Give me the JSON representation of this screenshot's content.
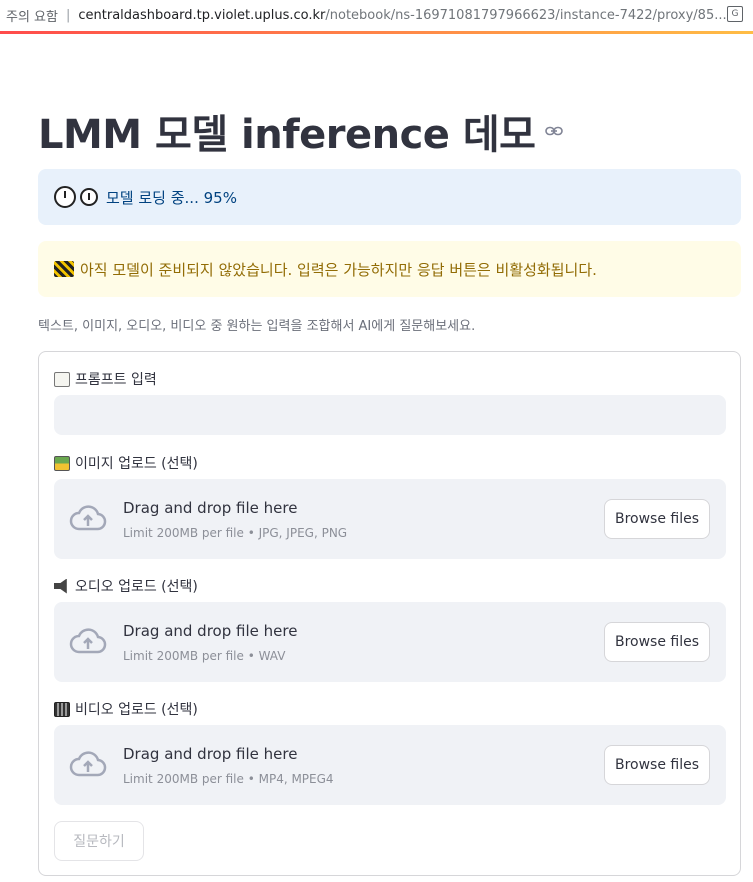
{
  "browser": {
    "security_label": "주의 요함",
    "url_host": "centraldashboard.tp.violet.uplus.co.kr",
    "url_path": "/notebook/ns-16971081797966623/instance-7422/proxy/85..."
  },
  "page": {
    "title": "LMM 모델 inference 데모",
    "loading_text": "모델 로딩 중... 95%",
    "warning_text": "아직 모델이 준비되지 않았습니다. 입력은 가능하지만 응답 버튼은 비활성화됩니다.",
    "caption": "텍스트, 이미지, 오디오, 비디오 중 원하는 입력을 조합해서 AI에게 질문해보세요."
  },
  "form": {
    "prompt_label": "프롬프트 입력",
    "prompt_value": "",
    "image_label": "이미지 업로드 (선택)",
    "audio_label": "오디오 업로드 (선택)",
    "video_label": "비디오 업로드 (선택)",
    "uploaders": [
      {
        "title": "Drag and drop file here",
        "limit": "Limit 200MB per file • JPG, JPEG, PNG",
        "button": "Browse files"
      },
      {
        "title": "Drag and drop file here",
        "limit": "Limit 200MB per file • WAV",
        "button": "Browse files"
      },
      {
        "title": "Drag and drop file here",
        "limit": "Limit 200MB per file • MP4, MPEG4",
        "button": "Browse files"
      }
    ],
    "submit_label": "질문하기",
    "submit_disabled": true
  },
  "colors": {
    "info_bg": "#e8f1fb",
    "info_text": "#004280",
    "warn_bg": "#fffce7",
    "warn_text": "#926c05",
    "dropzone_bg": "#f0f2f6",
    "accent_gradient_start": "#ff4b4b",
    "accent_gradient_end": "#ffbd45"
  },
  "icons": {
    "info": "stopwatch-icon",
    "warning": "construction-icon",
    "prompt": "memo-icon",
    "image": "framed-picture-icon",
    "audio": "speaker-icon",
    "video": "film-icon",
    "upload": "cloud-upload-icon",
    "title_anchor": "link-icon",
    "translate": "translate-icon"
  }
}
